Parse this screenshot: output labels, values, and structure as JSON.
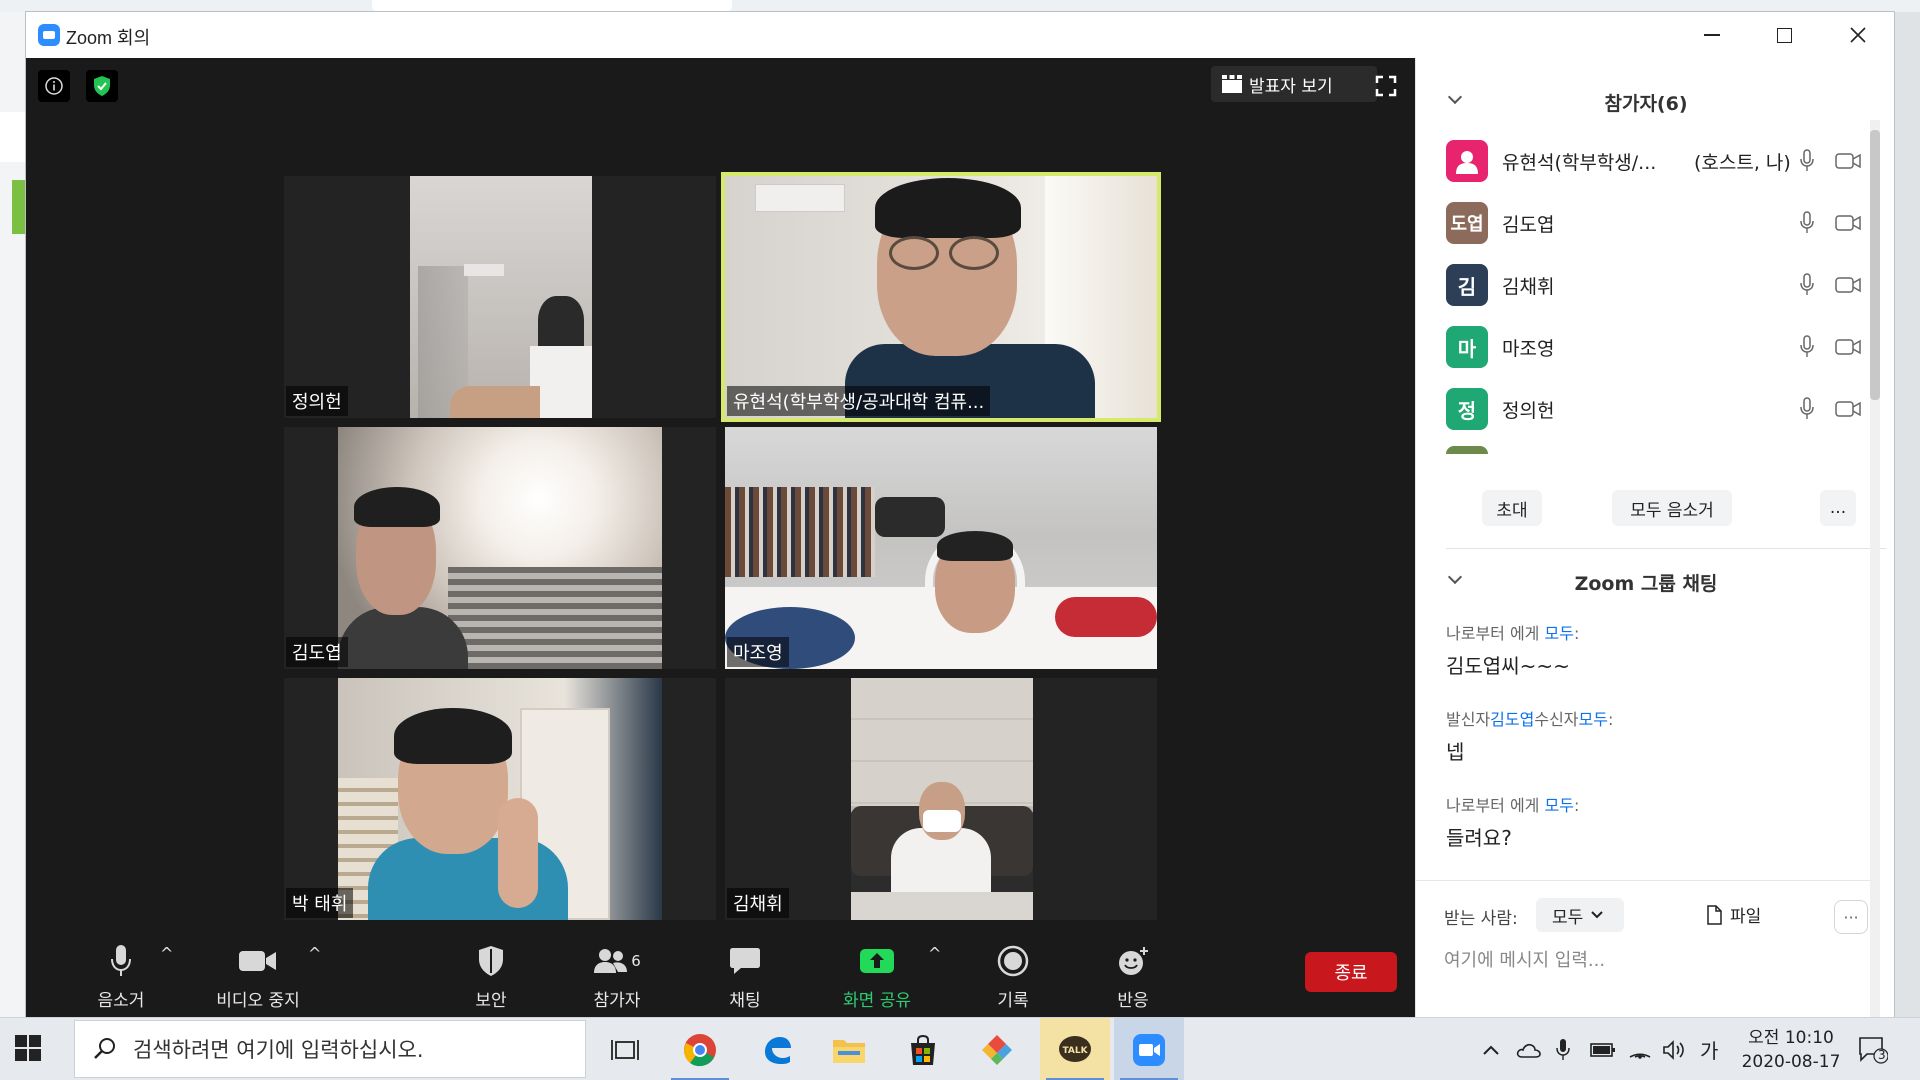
{
  "window": {
    "title": "Zoom 회의"
  },
  "meeting": {
    "speaker_view_label": "발표자 보기",
    "tiles": [
      {
        "name": "정의헌"
      },
      {
        "name": "유현석(학부학생/공과대학 컴퓨..."
      },
      {
        "name": "김도엽"
      },
      {
        "name": "마조영"
      },
      {
        "name": "박 태휘"
      },
      {
        "name": "김채휘"
      }
    ],
    "participant_count": "6"
  },
  "controls": {
    "mute": "음소거",
    "stop_video": "비디오 중지",
    "security": "보안",
    "participants": "참가자",
    "chat": "채팅",
    "share_screen": "화면 공유",
    "record": "기록",
    "reactions": "반응",
    "end": "종료",
    "share_color": "#23d959",
    "end_color": "#c8171d"
  },
  "participants_panel": {
    "title": "참가자(6)",
    "list": [
      {
        "avatar": "",
        "avatar_color": "#e8246f",
        "name": "유현석(학부학생/...",
        "role": "(호스트, 나)"
      },
      {
        "avatar": "도엽",
        "avatar_color": "#8c6a5c",
        "name": "김도엽",
        "role": ""
      },
      {
        "avatar": "김",
        "avatar_color": "#2d3e57",
        "name": "김채휘",
        "role": ""
      },
      {
        "avatar": "마",
        "avatar_color": "#1fa774",
        "name": "마조영",
        "role": ""
      },
      {
        "avatar": "정",
        "avatar_color": "#1fa774",
        "name": "정의헌",
        "role": ""
      }
    ],
    "invite": "초대",
    "mute_all": "모두 음소거",
    "more": "..."
  },
  "chat_panel": {
    "title": "Zoom 그룹 채팅",
    "messages": [
      {
        "meta_prefix": "나로부터 에게 ",
        "meta_link": "모두",
        "meta_suffix": ":",
        "text": "김도엽씨~~~"
      },
      {
        "meta_prefix": "발신자",
        "meta_link": "김도엽",
        "meta_mid": "수신자",
        "meta_link2": "모두",
        "meta_suffix": ":",
        "text": "넵"
      },
      {
        "meta_prefix": "나로부터 에게 ",
        "meta_link": "모두",
        "meta_suffix": ":",
        "text": "들려요?"
      }
    ],
    "to_label": "받는 사람:",
    "to_value": "모두",
    "file_label": "파일",
    "more": "···",
    "input_placeholder": "여기에 메시지 입력..."
  },
  "taskbar": {
    "search_placeholder": "검색하려면 여기에 입력하십시오.",
    "apps": [
      "task-view",
      "chrome",
      "edge",
      "file-explorer",
      "store",
      "photos",
      "kakaotalk",
      "zoom"
    ],
    "ime": "가",
    "time": "오전 10:10",
    "date": "2020-08-17",
    "notifications": "3"
  }
}
